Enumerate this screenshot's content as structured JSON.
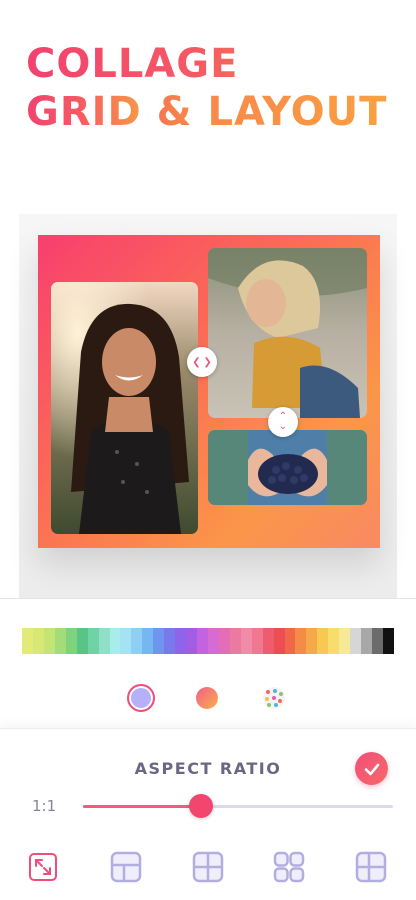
{
  "headline": {
    "line1": "COLLAGE",
    "line2_prefix": "GRID",
    "line2_amp": "&",
    "line2_suffix": "LAYOUT"
  },
  "collage": {
    "photos": [
      {
        "name": "smiling-woman-photo"
      },
      {
        "name": "blonde-woman-photo"
      },
      {
        "name": "blueberries-hands-photo"
      }
    ],
    "resize_handles": [
      "horizontal",
      "vertical"
    ]
  },
  "palette": {
    "swatches": [
      "#e3ea7c",
      "#d8e874",
      "#c2e573",
      "#a3dc78",
      "#7fd37c",
      "#58c586",
      "#6fd3a6",
      "#8fe0c6",
      "#a9ecec",
      "#a6e1f4",
      "#8fcff3",
      "#76b6f1",
      "#6f95ef",
      "#7a79ec",
      "#8f64ea",
      "#a35de2",
      "#c264df",
      "#d86bd1",
      "#e46eb6",
      "#ec7aa0",
      "#f28ba8",
      "#f07891",
      "#ef5b6f",
      "#ee4d52",
      "#f06848",
      "#f48b47",
      "#f5a949",
      "#f7c852",
      "#f7dd6c",
      "#f6ea95",
      "#d6d6d6",
      "#a8a8a8",
      "#6c6c6c",
      "#111111"
    ]
  },
  "background_options": {
    "selected": "solid",
    "solid_color": "#b6b0f9",
    "options": [
      "solid-color",
      "gradient",
      "pattern"
    ]
  },
  "panel": {
    "title": "ASPECT RATIO",
    "ratio_label": "1:1",
    "slider_value": 0.38,
    "accent": "#f2466f",
    "tools": [
      {
        "name": "expand-icon",
        "active": true
      },
      {
        "name": "grid-layout-1-icon",
        "active": false
      },
      {
        "name": "grid-layout-2-icon",
        "active": false
      },
      {
        "name": "grid-layout-3-icon",
        "active": false
      },
      {
        "name": "grid-layout-4-icon",
        "active": false
      }
    ]
  }
}
